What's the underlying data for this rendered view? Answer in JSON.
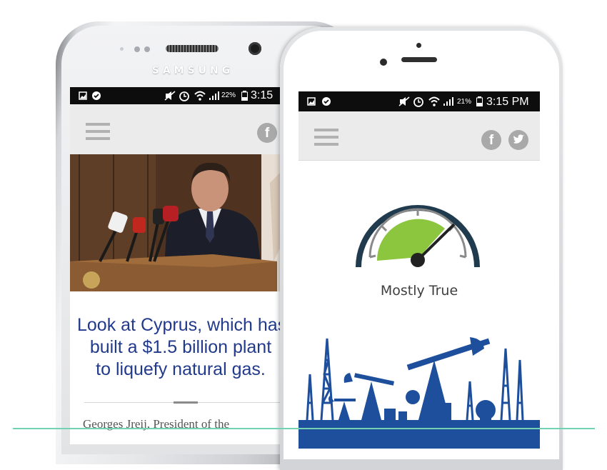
{
  "samsung_phone": {
    "brand": "SAMSUNG",
    "status": {
      "battery": "22%",
      "time": "3:15"
    },
    "headline": [
      "Look at Cyprus, which has",
      "built a $1.5 billion plant",
      "to liquefy natural gas."
    ],
    "body_text": "Georges Jreij, President of the"
  },
  "iphone": {
    "status": {
      "battery": "21%",
      "time": "3:15 PM"
    },
    "verdict": "Mostly True",
    "meter_level": 0.72
  },
  "icons": [
    "menu-icon",
    "facebook-icon",
    "twitter-icon",
    "gallery-icon",
    "check-icon",
    "mute-icon",
    "alarm-icon",
    "wifi-icon",
    "signal-icon",
    "battery-icon"
  ],
  "colors": {
    "headline": "#213a8b",
    "meter_fill": "#8cc63f",
    "meter_arc": "#1f3b4d",
    "oil_silhouette": "#1e4f9c",
    "accent_line": "#71d3b3"
  }
}
